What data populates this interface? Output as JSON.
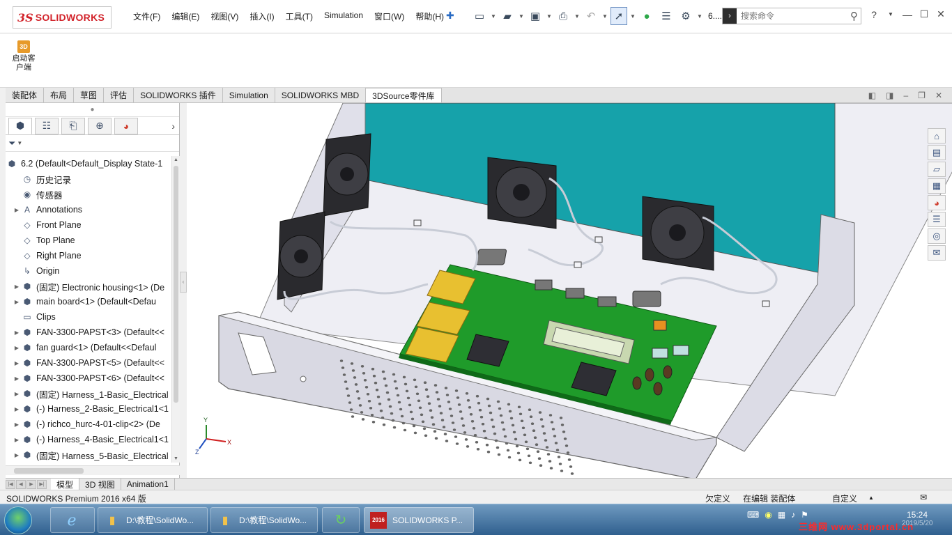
{
  "app": {
    "logo_mark": "3S",
    "logo_text": "SOLIDWORKS"
  },
  "menu": [
    "文件(F)",
    "编辑(E)",
    "视图(V)",
    "插入(I)",
    "工具(T)",
    "Simulation",
    "窗口(W)",
    "帮助(H)"
  ],
  "toolbar": {
    "version_label": "6...."
  },
  "search": {
    "placeholder": "搜索命令"
  },
  "ribbon": {
    "launch_label_1": "启动客",
    "launch_label_2": "户端",
    "launch_icon_text": "3D"
  },
  "command_tabs": [
    "装配体",
    "布局",
    "草图",
    "评估",
    "SOLIDWORKS 插件",
    "Simulation",
    "SOLIDWORKS MBD",
    "3DSource零件库"
  ],
  "feature_tree": {
    "root": "6.2  (Default<Default_Display State-1",
    "items": [
      {
        "label": "历史记录",
        "expand": false,
        "icon": "history-icon"
      },
      {
        "label": "传感器",
        "expand": false,
        "icon": "sensor-icon"
      },
      {
        "label": "Annotations",
        "expand": true,
        "icon": "annotation-icon"
      },
      {
        "label": "Front Plane",
        "expand": false,
        "icon": "plane-icon"
      },
      {
        "label": "Top Plane",
        "expand": false,
        "icon": "plane-icon"
      },
      {
        "label": "Right Plane",
        "expand": false,
        "icon": "plane-icon"
      },
      {
        "label": "Origin",
        "expand": false,
        "icon": "origin-icon"
      },
      {
        "label": "(固定) Electronic housing<1> (De",
        "expand": true,
        "icon": "part-icon"
      },
      {
        "label": "main board<1> (Default<Defau",
        "expand": true,
        "icon": "assembly-icon"
      },
      {
        "label": "Clips",
        "expand": false,
        "icon": "folder-icon"
      },
      {
        "label": "FAN-3300-PAPST<3> (Default<<",
        "expand": true,
        "icon": "part-icon"
      },
      {
        "label": "fan guard<1> (Default<<Defaul",
        "expand": true,
        "icon": "part-icon"
      },
      {
        "label": "FAN-3300-PAPST<5> (Default<<",
        "expand": true,
        "icon": "part-icon"
      },
      {
        "label": "FAN-3300-PAPST<6> (Default<<",
        "expand": true,
        "icon": "part-icon"
      },
      {
        "label": "(固定) Harness_1-Basic_Electrical",
        "expand": true,
        "icon": "harness-icon"
      },
      {
        "label": "(-) Harness_2-Basic_Electrical1<1",
        "expand": true,
        "icon": "harness-icon"
      },
      {
        "label": "(-) richco_hurc-4-01-clip<2> (De",
        "expand": true,
        "icon": "part-icon"
      },
      {
        "label": "(-) Harness_4-Basic_Electrical1<1",
        "expand": true,
        "icon": "harness-icon"
      },
      {
        "label": "(固定) Harness_5-Basic_Electrical",
        "expand": true,
        "icon": "harness-icon"
      }
    ]
  },
  "bottom_tabs": [
    "模型",
    "3D 视图",
    "Animation1"
  ],
  "status": {
    "product": "SOLIDWORKS Premium 2016 x64 版",
    "defined": "欠定义",
    "editing": "在编辑 装配体",
    "units": "自定义"
  },
  "triad": {
    "x": "X",
    "y": "Y",
    "z": "Z"
  },
  "taskbar": {
    "items": [
      "D:\\教程\\SolidWo...",
      "D:\\教程\\SolidWo...",
      "SOLIDWORKS P..."
    ],
    "sw_badge": "2016",
    "time": "15:24",
    "date": "2019/5/20"
  },
  "watermark": "三维网 www.3dportal.cn",
  "colors": {
    "housing_wall": "#d8d8e4",
    "back_panel": "#14a0a8",
    "pcb": "#1f9b2a",
    "gold": "#e8c030",
    "fan": "#2a2a2a",
    "accent_red": "#d2232a"
  }
}
